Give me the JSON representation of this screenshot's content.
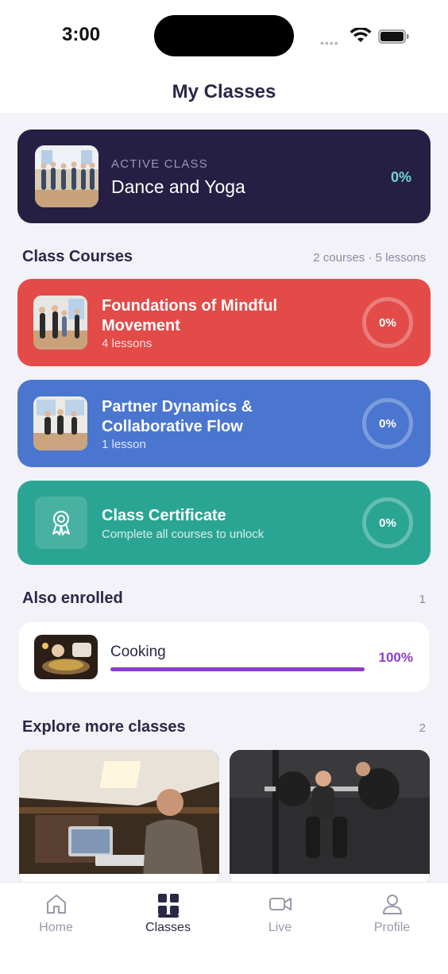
{
  "status_bar": {
    "time": "3:00"
  },
  "header": {
    "title": "My Classes"
  },
  "active_class": {
    "eyebrow": "ACTIVE CLASS",
    "name": "Dance and Yoga",
    "progress": "0%"
  },
  "class_courses": {
    "title": "Class Courses",
    "meta": "2 courses · 5 lessons",
    "items": [
      {
        "title": "Foundations of Mindful Movement",
        "subtitle": "4 lessons",
        "progress": "0%",
        "color": "#e24b48"
      },
      {
        "title": "Partner Dynamics & Collaborative Flow",
        "subtitle": "1 lesson",
        "progress": "0%",
        "color": "#4a76d0"
      }
    ],
    "certificate": {
      "title": "Class Certificate",
      "subtitle": "Complete all courses to unlock",
      "progress": "0%",
      "color": "#2aa593",
      "icon": "award-icon"
    }
  },
  "also_enrolled": {
    "title": "Also enrolled",
    "count": "1",
    "items": [
      {
        "name": "Cooking",
        "progress_label": "100%",
        "progress": 1.0
      }
    ]
  },
  "explore": {
    "title": "Explore more classes",
    "count": "2"
  },
  "tabs": [
    {
      "label": "Home",
      "icon": "home-icon"
    },
    {
      "label": "Classes",
      "icon": "grid-icon",
      "active": true
    },
    {
      "label": "Live",
      "icon": "video-icon"
    },
    {
      "label": "Profile",
      "icon": "person-icon"
    }
  ],
  "colors": {
    "accent_purple": "#8a3fc4",
    "navy": "#251f44",
    "teal_text": "#6fd3d6"
  }
}
